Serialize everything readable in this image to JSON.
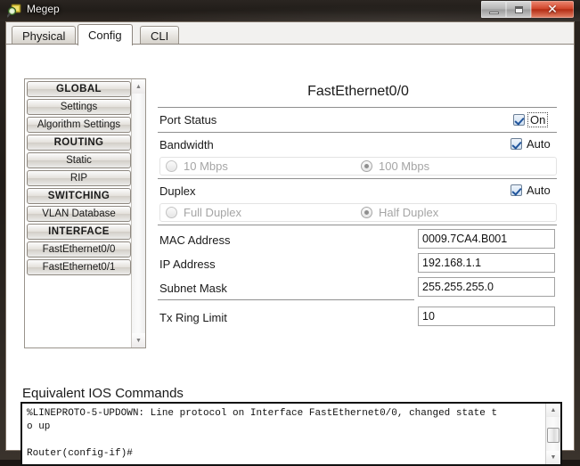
{
  "window": {
    "title": "Megep",
    "icon": "magnifier-icon",
    "controls": {
      "minimize": "Minimize",
      "maximize": "Maximize",
      "close": "Close",
      "close_glyph": "✕"
    }
  },
  "tabs": [
    {
      "label": "Physical",
      "active": false
    },
    {
      "label": "Config",
      "active": true
    },
    {
      "label": "CLI",
      "active": false
    }
  ],
  "sidebar": {
    "items": [
      {
        "label": "GLOBAL",
        "header": true
      },
      {
        "label": "Settings",
        "header": false
      },
      {
        "label": "Algorithm Settings",
        "header": false
      },
      {
        "label": "ROUTING",
        "header": true
      },
      {
        "label": "Static",
        "header": false
      },
      {
        "label": "RIP",
        "header": false
      },
      {
        "label": "SWITCHING",
        "header": true
      },
      {
        "label": "VLAN Database",
        "header": false
      },
      {
        "label": "INTERFACE",
        "header": true
      },
      {
        "label": "FastEthernet0/0",
        "header": false
      },
      {
        "label": "FastEthernet0/1",
        "header": false
      }
    ],
    "scroll_up": "▲",
    "scroll_down": "▼"
  },
  "config": {
    "title": "FastEthernet0/0",
    "port_status": {
      "label": "Port Status",
      "checkbox_label": "On",
      "checked": true
    },
    "bandwidth": {
      "label": "Bandwidth",
      "auto_label": "Auto",
      "auto_checked": true,
      "options": [
        {
          "label": "10 Mbps",
          "selected": false
        },
        {
          "label": "100 Mbps",
          "selected": true
        }
      ]
    },
    "duplex": {
      "label": "Duplex",
      "auto_label": "Auto",
      "auto_checked": true,
      "options": [
        {
          "label": "Full Duplex",
          "selected": false
        },
        {
          "label": "Half Duplex",
          "selected": true
        }
      ]
    },
    "fields": [
      {
        "label": "MAC Address",
        "value": "0009.7CA4.B001"
      },
      {
        "label": "IP Address",
        "value": "192.168.1.1"
      },
      {
        "label": "Subnet Mask",
        "value": "255.255.255.0"
      },
      {
        "label": "Tx Ring Limit",
        "value": "10"
      }
    ]
  },
  "ios": {
    "title": "Equivalent IOS Commands",
    "text": "%LINEPROTO-5-UPDOWN: Line protocol on Interface FastEthernet0/0, changed state t\no up\n\nRouter(config-if)#",
    "scroll_up": "▲",
    "scroll_down": "▼"
  },
  "colors": {
    "accent_blue": "#21559c",
    "close_red": "#d2472c",
    "text": "#1a1a1a",
    "disabled_text": "#a5a5a5"
  }
}
